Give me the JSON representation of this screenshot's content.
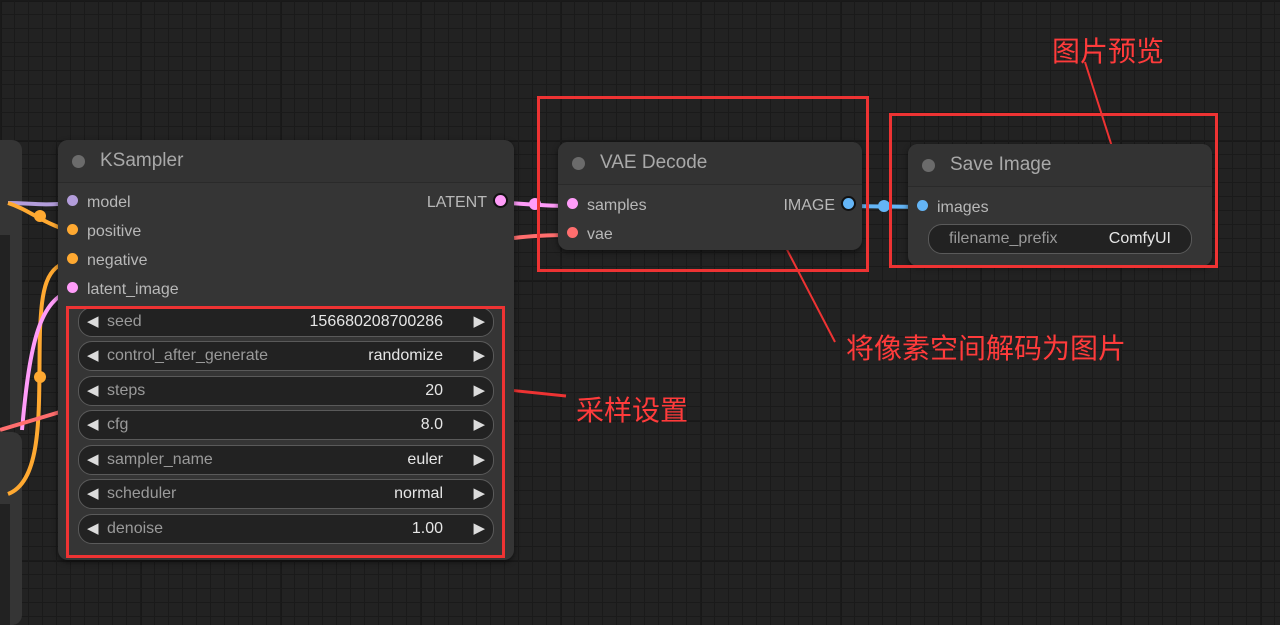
{
  "nodes": {
    "ksampler": {
      "title": "KSampler",
      "inputs": [
        {
          "label": "model",
          "color": "#b39ddb"
        },
        {
          "label": "positive",
          "color": "#ffa931"
        },
        {
          "label": "negative",
          "color": "#ffa931"
        },
        {
          "label": "latent_image",
          "color": "#ff9cf9"
        }
      ],
      "output": {
        "label": "LATENT",
        "color": "#ff9cf9"
      },
      "widgets": [
        {
          "label": "seed",
          "value": "156680208700286"
        },
        {
          "label": "control_after_generate",
          "value": "randomize"
        },
        {
          "label": "steps",
          "value": "20"
        },
        {
          "label": "cfg",
          "value": "8.0"
        },
        {
          "label": "sampler_name",
          "value": "euler"
        },
        {
          "label": "scheduler",
          "value": "normal"
        },
        {
          "label": "denoise",
          "value": "1.00"
        }
      ]
    },
    "vae_decode": {
      "title": "VAE Decode",
      "inputs": [
        {
          "label": "samples",
          "color": "#ff9cf9"
        },
        {
          "label": "vae",
          "color": "#ff6e6e"
        }
      ],
      "output": {
        "label": "IMAGE",
        "color": "#64b5f6"
      }
    },
    "save_image": {
      "title": "Save Image",
      "inputs": [
        {
          "label": "images",
          "color": "#64b5f6"
        }
      ],
      "widget": {
        "label": "filename_prefix",
        "value": "ComfyUI"
      }
    }
  },
  "annotations": {
    "image_preview": "图片预览",
    "decode_note": "将像素空间解码为图片",
    "sampling_settings": "采样设置"
  },
  "colors": {
    "annotation_red": "#ee3333",
    "wire_model": "#b39ddb",
    "wire_conditioning": "#ffa931",
    "wire_latent": "#ff9cf9",
    "wire_vae": "#ff6e6e",
    "wire_image": "#64b5f6"
  }
}
